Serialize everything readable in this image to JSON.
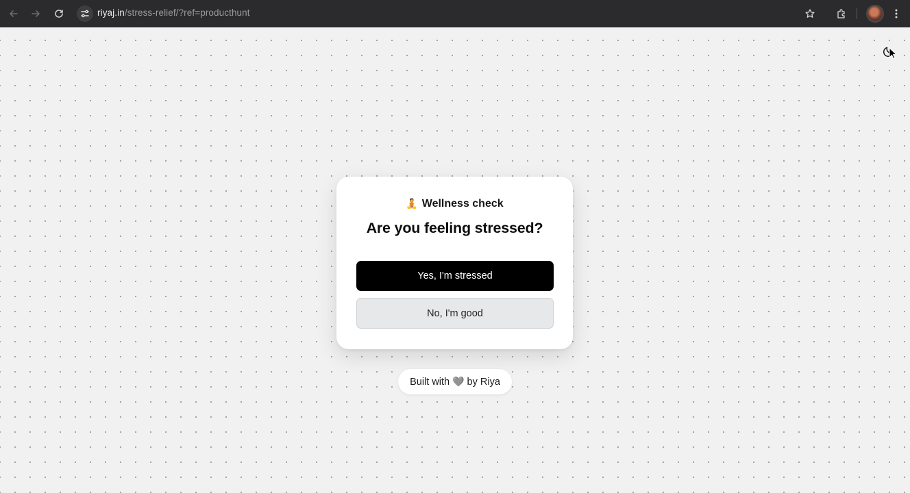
{
  "browser": {
    "url_host": "riyaj.in",
    "url_path": "/stress-relief/?ref=producthunt"
  },
  "card": {
    "kicker_emoji": "🧘",
    "kicker": "Wellness check",
    "title": "Are you feeling stressed?",
    "yes_label": "Yes, I'm stressed",
    "no_label": "No, I'm good"
  },
  "footer": {
    "prefix": "Built with",
    "heart": "🩶",
    "suffix": "by Riya"
  },
  "icons": {
    "back": "back-arrow-icon",
    "forward": "forward-arrow-icon",
    "reload": "reload-icon",
    "site_settings": "tune-icon",
    "bookmark": "star-icon",
    "extensions": "puzzle-icon",
    "menu": "kebab-menu-icon",
    "theme": "moon-icon"
  },
  "colors": {
    "primary_button": "#000000",
    "secondary_button": "#e6e8ea",
    "page_bg": "#f1f1f1",
    "browser_chrome": "#2b2b2d"
  }
}
